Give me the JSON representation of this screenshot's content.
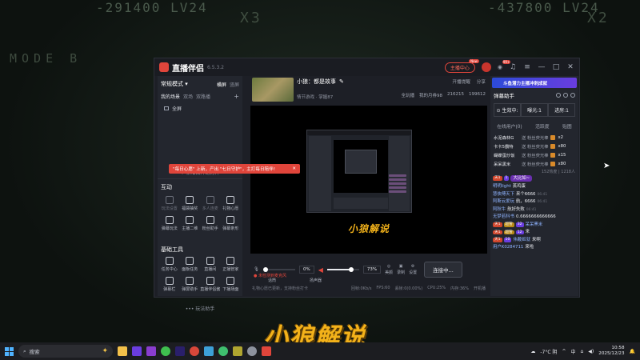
{
  "background": {
    "top_left_text": "-291400 LV24",
    "top_left_text2": "X3",
    "top_right_text": "-437800 LV24",
    "top_right_text2": "X2",
    "left_text": "MODE  B",
    "bottom_logo": "小狼解说"
  },
  "window": {
    "app_name": "直播伴侣",
    "version": "6.5.3.2",
    "host_center_label": "主播中心",
    "host_center_badge": "New",
    "notification_count": "99+",
    "controls": [
      "—",
      "□",
      "✕"
    ]
  },
  "left_panel": {
    "mode_label": "常规模式 ▾",
    "tabs": [
      "横屏",
      "竖屏"
    ],
    "active_tab": "横屏",
    "scene_labels": [
      "我的场景",
      "双场",
      "双路播"
    ],
    "source_item": "全屏",
    "add_source": "+ 新增图片幻灯片",
    "interact_title": "互动",
    "tip_text": "\"每日心愿\" 上新，产出 \"七日守护\"，主打每日陪伴!",
    "tip_close": "✕",
    "interact_tools": [
      {
        "label": "玩法设置",
        "dim": true,
        "icon": "mic-icon"
      },
      {
        "label": "福袋抽奖",
        "dim": false,
        "icon": "gift-bag-icon"
      },
      {
        "label": "多人连麦",
        "dim": true,
        "icon": "multi-user-icon"
      },
      {
        "label": "礼物心愿",
        "dim": false,
        "icon": "download-icon"
      },
      {
        "label": "弹幕玩法",
        "dim": false,
        "icon": "download-icon"
      },
      {
        "label": "主播二维",
        "dim": false,
        "icon": "qr-icon"
      },
      {
        "label": "粉丝助手",
        "dim": false,
        "icon": "fan-icon"
      },
      {
        "label": "弹幕条形",
        "dim": false,
        "icon": "download-icon"
      }
    ],
    "basic_title": "基础工具",
    "basic_tools": [
      {
        "label": "任务中心",
        "icon": "task-icon"
      },
      {
        "label": "面板任务",
        "icon": "panel-icon"
      },
      {
        "label": "直播间",
        "icon": "room-icon"
      },
      {
        "label": "正播管家",
        "icon": "manage-icon"
      },
      {
        "label": "弹幕栏",
        "icon": "danmu-icon"
      },
      {
        "label": "弹屏助手",
        "icon": "helper-icon"
      },
      {
        "label": "直播伴侣酱",
        "icon": "bot-icon"
      },
      {
        "label": "下播场面",
        "icon": "end-icon"
      }
    ],
    "more_label": "••• 玩法助手"
  },
  "center": {
    "stream_title": "小狼：都是故事",
    "category": "情节游戏 · 掌握87",
    "top_actions": [
      "开播提醒",
      "分享"
    ],
    "stats": [
      "全玩播",
      "我的月券98",
      "216215",
      "199612"
    ],
    "preview_logo": "小狼解说",
    "mic_percent": "0%",
    "speaker_percent": "73%",
    "mic_label": "话筒",
    "speaker_label": "扬声器",
    "actions": [
      "美颜",
      "录制",
      "设置"
    ],
    "stream_button": "连接中...",
    "mic_warning": "未检测到麦克风",
    "status_left": "礼物心愿已更新，支持粉丝打卡",
    "status_right": [
      "回帧:0Kb/s",
      "FPS:60",
      "丢帧:0(0.00%)",
      "CPU:25%",
      "内存:36%",
      "开机播"
    ]
  },
  "right_panel": {
    "banner": "斗鱼潜力主播冲刺成就",
    "helper_title": "弹幕助手",
    "effect_left": "生效中:",
    "effect_mid": "曝光:1",
    "effect_right": "进房:1",
    "tabs": [
      "在线用户(0)",
      "活跃度",
      "贴图"
    ],
    "ranking": [
      {
        "name": "水泥森林G",
        "act": "送 粉丝荧光棒",
        "count": "x2"
      },
      {
        "name": "卡卡5霸特",
        "act": "送 粉丝荧光棒",
        "count": "x80"
      },
      {
        "name": "蝴蝶蛋炒饭",
        "act": "送 粉丝荧光棒",
        "count": "x15"
      },
      {
        "name": "呆呆黑米",
        "act": "送 粉丝荧光棒",
        "count": "x80"
      }
    ],
    "online_count": "152热度 | 1218人",
    "messages": [
      {
        "badges": [
          "天1",
          "1"
        ],
        "user": "",
        "text": "大比如~",
        "time": "",
        "bubble": true
      },
      {
        "badges": [],
        "user": "明明light",
        "text": "蒸鸡蛋",
        "time": "",
        "bubble": false
      },
      {
        "badges": [],
        "user": "慧侠傅天下",
        "text": "来个6666",
        "time": "06:41",
        "bubble": false
      },
      {
        "badges": [],
        "user": "阿斯云爱玩",
        "text": "航，6666",
        "time": "06:41",
        "bubble": false
      },
      {
        "badges": [],
        "user": "阿秋牛",
        "text": "航好失败",
        "time": "06:41",
        "bubble": false
      },
      {
        "badges": [],
        "user": "无梦若科书",
        "text": "0.6666666666666",
        "time": "",
        "bubble": false
      },
      {
        "badges": [
          "天1",
          "超管",
          "32"
        ],
        "user": "呆呆黑米",
        "text": "",
        "time": "",
        "bubble": false
      },
      {
        "badges": [
          "天1",
          "超管",
          "12"
        ],
        "user": "",
        "text": "来",
        "time": "",
        "bubble": false
      },
      {
        "badges": [
          "天1",
          "10"
        ],
        "user": "伟戴姬就",
        "text": "来啊",
        "time": "",
        "bubble": false
      },
      {
        "badges": [],
        "user": "用户K0284711",
        "text": "来啦",
        "time": "",
        "bubble": false
      }
    ]
  },
  "taskbar": {
    "search_placeholder": "搜索",
    "weather": "-7°C 阴",
    "lang": "中",
    "time": "10:58",
    "date": "2025/12/23",
    "apps": [
      {
        "name": "file-explorer-icon",
        "color": "#f3c04a"
      },
      {
        "name": "terminal-icon",
        "color": "#6a3de0"
      },
      {
        "name": "media-player-icon",
        "color": "#8a3dd0"
      },
      {
        "name": "wechat-icon",
        "color": "#3fbf4f"
      },
      {
        "name": "after-effects-icon",
        "color": "#2a1f6b"
      },
      {
        "name": "app-icon-1",
        "color": "#d8473a"
      },
      {
        "name": "app-icon-2",
        "color": "#3da0d8"
      },
      {
        "name": "chat-icon",
        "color": "#3fbf6f"
      },
      {
        "name": "game-icon",
        "color": "#b0a530"
      },
      {
        "name": "settings-icon",
        "color": "#8d929e"
      },
      {
        "name": "live-companion-icon",
        "color": "#e0453b"
      }
    ]
  }
}
